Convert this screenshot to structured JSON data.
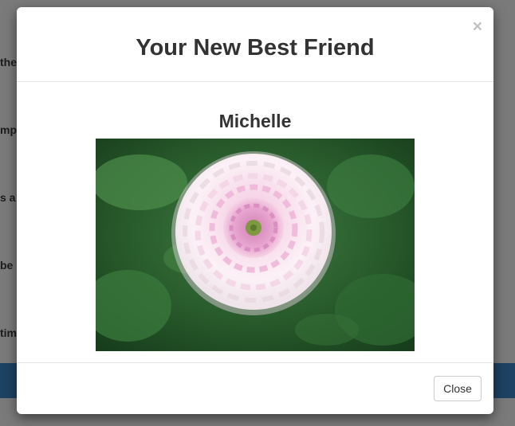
{
  "backdrop": {
    "snippets": [
      "ther",
      "mpo",
      "s a",
      "be",
      "tim"
    ]
  },
  "modal": {
    "title": "Your New Best Friend",
    "close_symbol": "×",
    "friend_name": "Michelle",
    "photo_icon": "flower-photo",
    "close_button_label": "Close"
  },
  "colors": {
    "backdrop": "#7a7a7a",
    "bar": "#1d4263",
    "text": "#333333",
    "petal": "#fbf2f7",
    "petal_pink": "#e9a9d1",
    "leaf": "#2e6a34"
  }
}
